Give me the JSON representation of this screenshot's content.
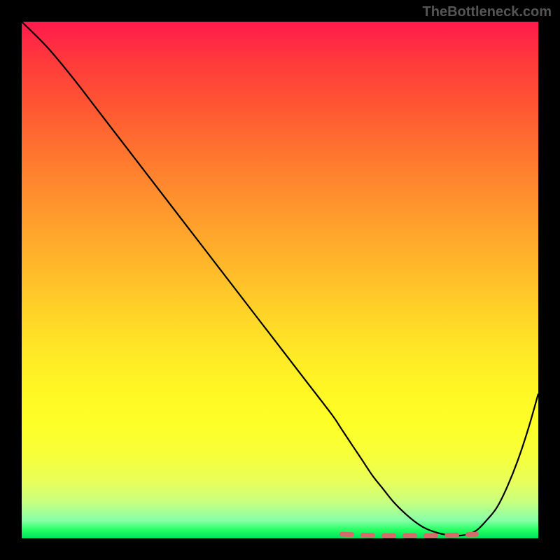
{
  "watermark": "TheBottleneck.com",
  "chart_data": {
    "type": "line",
    "title": "",
    "xlabel": "",
    "ylabel": "",
    "xlim": [
      0,
      100
    ],
    "ylim": [
      0,
      100
    ],
    "background": "rainbow-gradient red-top green-bottom",
    "series": [
      {
        "name": "main-curve",
        "x": [
          0,
          5,
          10,
          15,
          20,
          25,
          30,
          35,
          40,
          45,
          50,
          55,
          60,
          62,
          64,
          66,
          68,
          70,
          72,
          74,
          76,
          78,
          80,
          82,
          84,
          86,
          88,
          90,
          92,
          94,
          96,
          98,
          100
        ],
        "values": [
          100,
          95,
          89,
          82.5,
          76,
          69.5,
          63,
          56.5,
          50,
          43.5,
          37,
          30.5,
          24,
          21,
          18,
          15,
          12,
          9.5,
          7,
          5,
          3.3,
          2,
          1.2,
          0.7,
          0.5,
          0.7,
          1.5,
          3.5,
          6,
          10,
          15,
          21,
          28
        ]
      },
      {
        "name": "highlighted-range",
        "x": [
          62,
          64,
          66,
          68,
          70,
          74,
          76,
          80,
          82,
          84,
          86,
          88
        ],
        "values": [
          0.8,
          0.7,
          0.6,
          0.55,
          0.5,
          0.5,
          0.5,
          0.5,
          0.55,
          0.6,
          0.7,
          0.8
        ],
        "style": "dashed-red"
      }
    ]
  }
}
